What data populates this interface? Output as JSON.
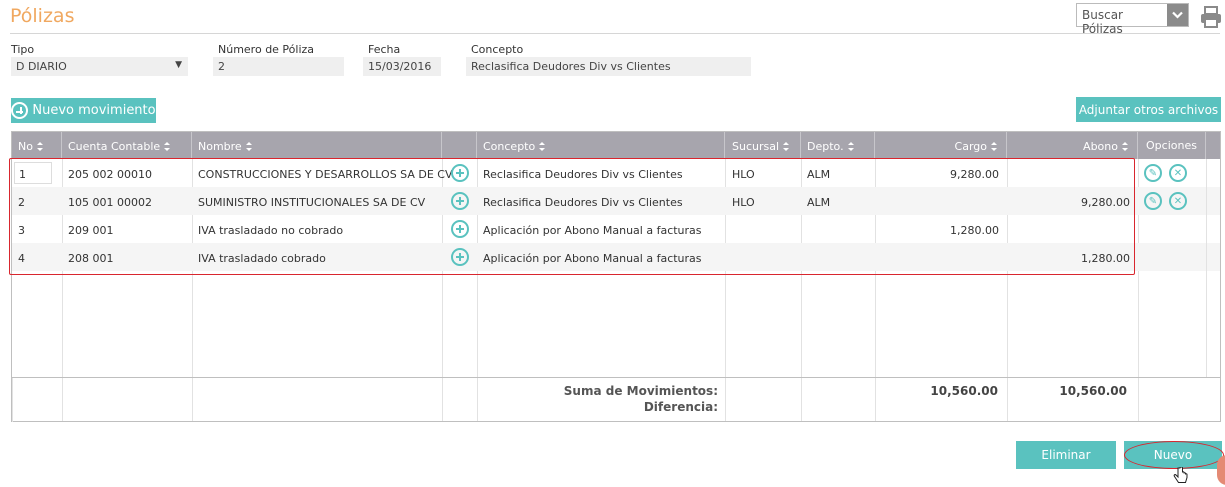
{
  "page": {
    "title": "Pólizas"
  },
  "search": {
    "label": "Buscar Pólizas"
  },
  "form": {
    "tipo_label": "Tipo",
    "tipo_value": "D DIARIO",
    "numero_label": "Número de Póliza",
    "numero_value": "2",
    "fecha_label": "Fecha",
    "fecha_value": "15/03/2016",
    "concepto_label": "Concepto",
    "concepto_value": "Reclasifica Deudores Div vs Clientes"
  },
  "toolbar": {
    "nuevo_movimiento": "Nuevo movimiento",
    "adjuntar": "Adjuntar otros archivos"
  },
  "grid": {
    "headers": {
      "no": "No",
      "cuenta": "Cuenta Contable",
      "nombre": "Nombre",
      "concepto": "Concepto",
      "sucursal": "Sucursal",
      "depto": "Depto.",
      "cargo": "Cargo",
      "abono": "Abono",
      "opciones": "Opciones"
    },
    "rows": [
      {
        "no": "1",
        "cuenta": "205 002 00010",
        "nombre": "CONSTRUCCIONES Y DESARROLLOS SA DE CV",
        "concepto": "Reclasifica Deudores Div vs Clientes",
        "sucursal": "HLO",
        "depto": "ALM",
        "cargo": "9,280.00",
        "abono": ""
      },
      {
        "no": "2",
        "cuenta": "105 001 00002",
        "nombre": "SUMINISTRO INSTITUCIONALES SA DE CV",
        "concepto": "Reclasifica Deudores Div vs Clientes",
        "sucursal": "HLO",
        "depto": "ALM",
        "cargo": "",
        "abono": "9,280.00"
      },
      {
        "no": "3",
        "cuenta": "209 001",
        "nombre": "IVA trasladado no cobrado",
        "concepto": "Aplicación por Abono Manual a facturas",
        "sucursal": "",
        "depto": "",
        "cargo": "1,280.00",
        "abono": ""
      },
      {
        "no": "4",
        "cuenta": "208 001",
        "nombre": "IVA trasladado cobrado",
        "concepto": "Aplicación por Abono Manual a facturas",
        "sucursal": "",
        "depto": "",
        "cargo": "",
        "abono": "1,280.00"
      }
    ],
    "footer": {
      "suma_label": "Suma de Movimientos:",
      "diferencia_label": "Diferencia:",
      "suma_cargo": "10,560.00",
      "suma_abono": "10,560.00"
    }
  },
  "actions": {
    "eliminar": "Eliminar",
    "nuevo": "Nuevo"
  },
  "colors": {
    "accent": "#5ac2bf",
    "title": "#f0a860",
    "header_bg": "#a7a5ad",
    "highlight": "#d9262e"
  }
}
